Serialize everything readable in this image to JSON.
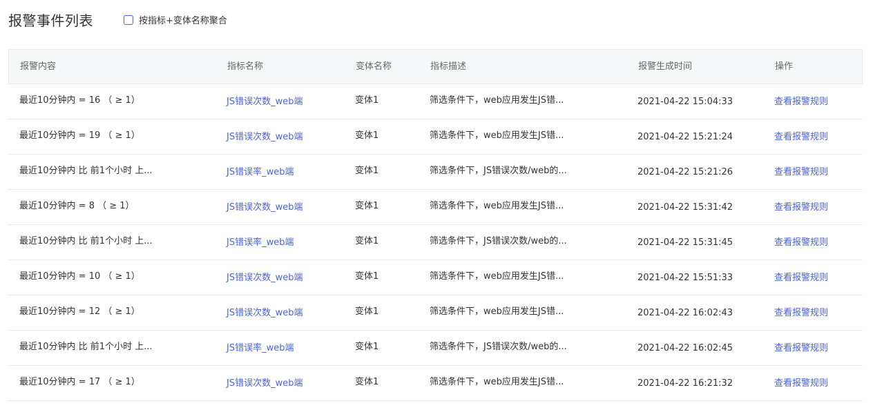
{
  "title": "报警事件列表",
  "aggregate_checkbox": {
    "label": "按指标+变体名称聚合",
    "checked": false
  },
  "colors": {
    "accent": "#4a63d8",
    "header_bg": "#f7f8fa",
    "border": "#e8e8e8"
  },
  "columns": [
    "报警内容",
    "指标名称",
    "变体名称",
    "指标描述",
    "报警生成时间",
    "操作"
  ],
  "rows": [
    {
      "content": "最近10分钟内 = 16 （ ≥ 1）",
      "metric": "JS错误次数_web端",
      "variant": "变体1",
      "desc": "筛选条件下，web应用发生JS错...",
      "time": "2021-04-22 15:04:33",
      "action": "查看报警规则"
    },
    {
      "content": "最近10分钟内 = 19 （ ≥ 1）",
      "metric": "JS错误次数_web端",
      "variant": "变体1",
      "desc": "筛选条件下，web应用发生JS错...",
      "time": "2021-04-22 15:21:24",
      "action": "查看报警规则"
    },
    {
      "content": "最近10分钟内 比 前1个小时 上...",
      "metric": "JS错误率_web端",
      "variant": "变体1",
      "desc": "筛选条件下，JS错误次数/web的...",
      "time": "2021-04-22 15:21:26",
      "action": "查看报警规则"
    },
    {
      "content": "最近10分钟内 = 8 （ ≥ 1）",
      "metric": "JS错误次数_web端",
      "variant": "变体1",
      "desc": "筛选条件下，web应用发生JS错...",
      "time": "2021-04-22 15:31:42",
      "action": "查看报警规则"
    },
    {
      "content": "最近10分钟内 比 前1个小时 上...",
      "metric": "JS错误率_web端",
      "variant": "变体1",
      "desc": "筛选条件下，JS错误次数/web的...",
      "time": "2021-04-22 15:31:45",
      "action": "查看报警规则"
    },
    {
      "content": "最近10分钟内 = 10 （ ≥ 1）",
      "metric": "JS错误次数_web端",
      "variant": "变体1",
      "desc": "筛选条件下，web应用发生JS错...",
      "time": "2021-04-22 15:51:33",
      "action": "查看报警规则"
    },
    {
      "content": "最近10分钟内 = 12 （ ≥ 1）",
      "metric": "JS错误次数_web端",
      "variant": "变体1",
      "desc": "筛选条件下，web应用发生JS错...",
      "time": "2021-04-22 16:02:43",
      "action": "查看报警规则"
    },
    {
      "content": "最近10分钟内 比 前1个小时 上...",
      "metric": "JS错误率_web端",
      "variant": "变体1",
      "desc": "筛选条件下，JS错误次数/web的...",
      "time": "2021-04-22 16:02:45",
      "action": "查看报警规则"
    },
    {
      "content": "最近10分钟内 = 17 （ ≥ 1）",
      "metric": "JS错误次数_web端",
      "variant": "变体1",
      "desc": "筛选条件下，web应用发生JS错...",
      "time": "2021-04-22 16:21:32",
      "action": "查看报警规则"
    }
  ]
}
